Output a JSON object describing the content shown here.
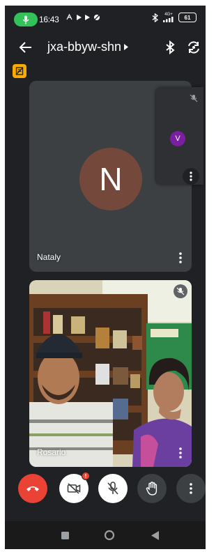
{
  "status_bar": {
    "time": "16:43",
    "network_label": "4G+",
    "battery": "61",
    "icons": [
      "mic-icon",
      "hotspot-icon",
      "play-icon",
      "play-icon",
      "blocked-icon",
      "bluetooth-icon",
      "signal-icon",
      "battery-icon"
    ]
  },
  "header": {
    "title": "jxa-bbyw-shn",
    "icons": [
      "back-arrow-icon",
      "bluetooth-icon",
      "switch-camera-icon"
    ]
  },
  "tiles": {
    "main": {
      "name": "Nataly",
      "initial": "N",
      "avatar_color": "#74493b"
    },
    "self": {
      "initial": "V",
      "avatar_color": "#7b1fa2",
      "muted": true
    },
    "video": {
      "name": "Rosario",
      "muted": true
    }
  },
  "controls": {
    "end_call": {
      "icon": "end-call-icon",
      "color": "#ea4335"
    },
    "camera": {
      "icon": "camera-off-icon",
      "alert": "!"
    },
    "mic": {
      "icon": "mic-off-icon"
    },
    "raise_hand": {
      "icon": "hand-icon"
    },
    "more": {
      "icon": "more-vert-icon"
    }
  },
  "navbar": {
    "icons": [
      "recents-icon",
      "home-icon",
      "back-icon"
    ]
  },
  "colors": {
    "background": "#202124",
    "tile": "#3c4043",
    "accent_green": "#33c15a",
    "danger": "#ea4335",
    "badge": "#f9ab00"
  }
}
